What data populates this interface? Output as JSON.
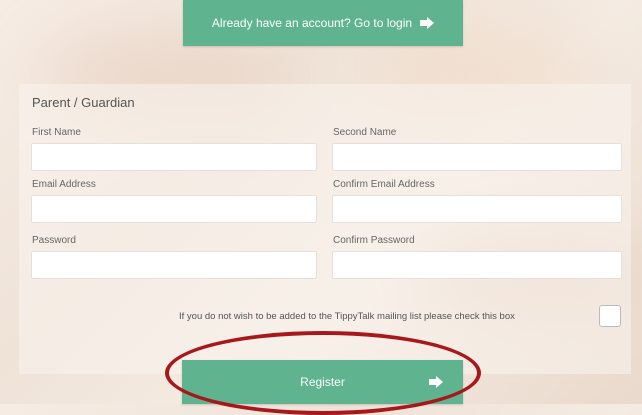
{
  "login_banner": {
    "text": "Already have an account? Go to login",
    "icon": "arrow-right-icon"
  },
  "form": {
    "section_title": "Parent / Guardian",
    "fields": {
      "first_name": {
        "label": "First Name",
        "value": ""
      },
      "second_name": {
        "label": "Second Name",
        "value": ""
      },
      "email": {
        "label": "Email Address",
        "value": ""
      },
      "confirm_email": {
        "label": "Confirm Email Address",
        "value": ""
      },
      "password": {
        "label": "Password",
        "value": ""
      },
      "confirm_password": {
        "label": "Confirm Password",
        "value": ""
      }
    },
    "mailing_opt_out": {
      "text": "If you do not wish to be added to the TippyTalk mailing list please check this box",
      "checked": false
    },
    "register_button": {
      "label": "Register",
      "icon": "arrow-right-icon"
    }
  },
  "colors": {
    "accent": "#5fb48f",
    "annotation": "#a6181c"
  }
}
